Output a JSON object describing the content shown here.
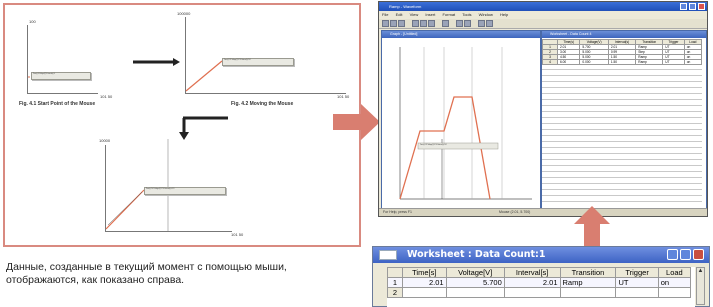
{
  "figures": {
    "fig1": {
      "caption": "Fig. 4.1 Start Point of the Mouse",
      "y_axis_label": "100",
      "x_axis_label": "101 50",
      "tooltip": "Time(s):0 Voltage(V):0 Interval(s):0"
    },
    "fig2": {
      "caption": "Fig. 4.2 Moving the Mouse",
      "y_axis_label": "100000",
      "x_axis_label": "101 50",
      "tooltip": "Time(s):2.01 Voltage(V):5.700 Interval(s):2.01"
    },
    "fig3": {
      "y_axis_label": "10000",
      "x_axis_label": "101 50",
      "tooltip": "Time(s):2.01 Voltage(V):5.700 Interval(s):2.01"
    }
  },
  "description": "Данные, созданные в текущий момент с помощью мыши, отображаются, как показано справа.",
  "app": {
    "title": "Ramp - Waveform",
    "menu": [
      "File",
      "Edit",
      "View",
      "Insert",
      "Format",
      "Tools",
      "Window",
      "Help"
    ],
    "graph_window_title": "Graph - [Untitled]",
    "graph_tooltip": "Time(s):2.01 Voltage(V):5.700 Interval(s):2.01",
    "worksheet_window_title": "Worksheet - Data Count 4",
    "worksheet_headers": [
      "Time(s)",
      "Voltage(V)",
      "Interval(s)",
      "Transition",
      "Trigger",
      "Load"
    ],
    "worksheet_rows": [
      [
        "2.01",
        "5.700",
        "2.01",
        "Ramp",
        "UT",
        "on"
      ],
      [
        "3.00",
        "5.000",
        "0.99",
        "Step",
        "UT",
        "on"
      ],
      [
        "4.50",
        "5.000",
        "1.50",
        "Ramp",
        "UT",
        "on"
      ],
      [
        "6.00",
        "0.000",
        "1.50",
        "Ramp",
        "UT",
        "on"
      ]
    ],
    "status_left": "For Help, press F1",
    "status_right": "Mouse (2.01, 5.700)"
  },
  "worksheet": {
    "title": "Worksheet : Data Count:1",
    "headers": [
      "Time[s]",
      "Voltage[V]",
      "Interval[s]",
      "Transition",
      "Trigger",
      "Load"
    ],
    "row_numbers": [
      "1",
      "2"
    ],
    "row1": {
      "time": "2.01",
      "voltage": "5.700",
      "interval": "2.01",
      "transition": "Ramp",
      "trigger": "UT",
      "load": "on"
    }
  },
  "colors": {
    "frame": "#d98a80",
    "arrow": "#d97e70",
    "curve": "#e07050",
    "title_bar": "#3d63c4"
  }
}
